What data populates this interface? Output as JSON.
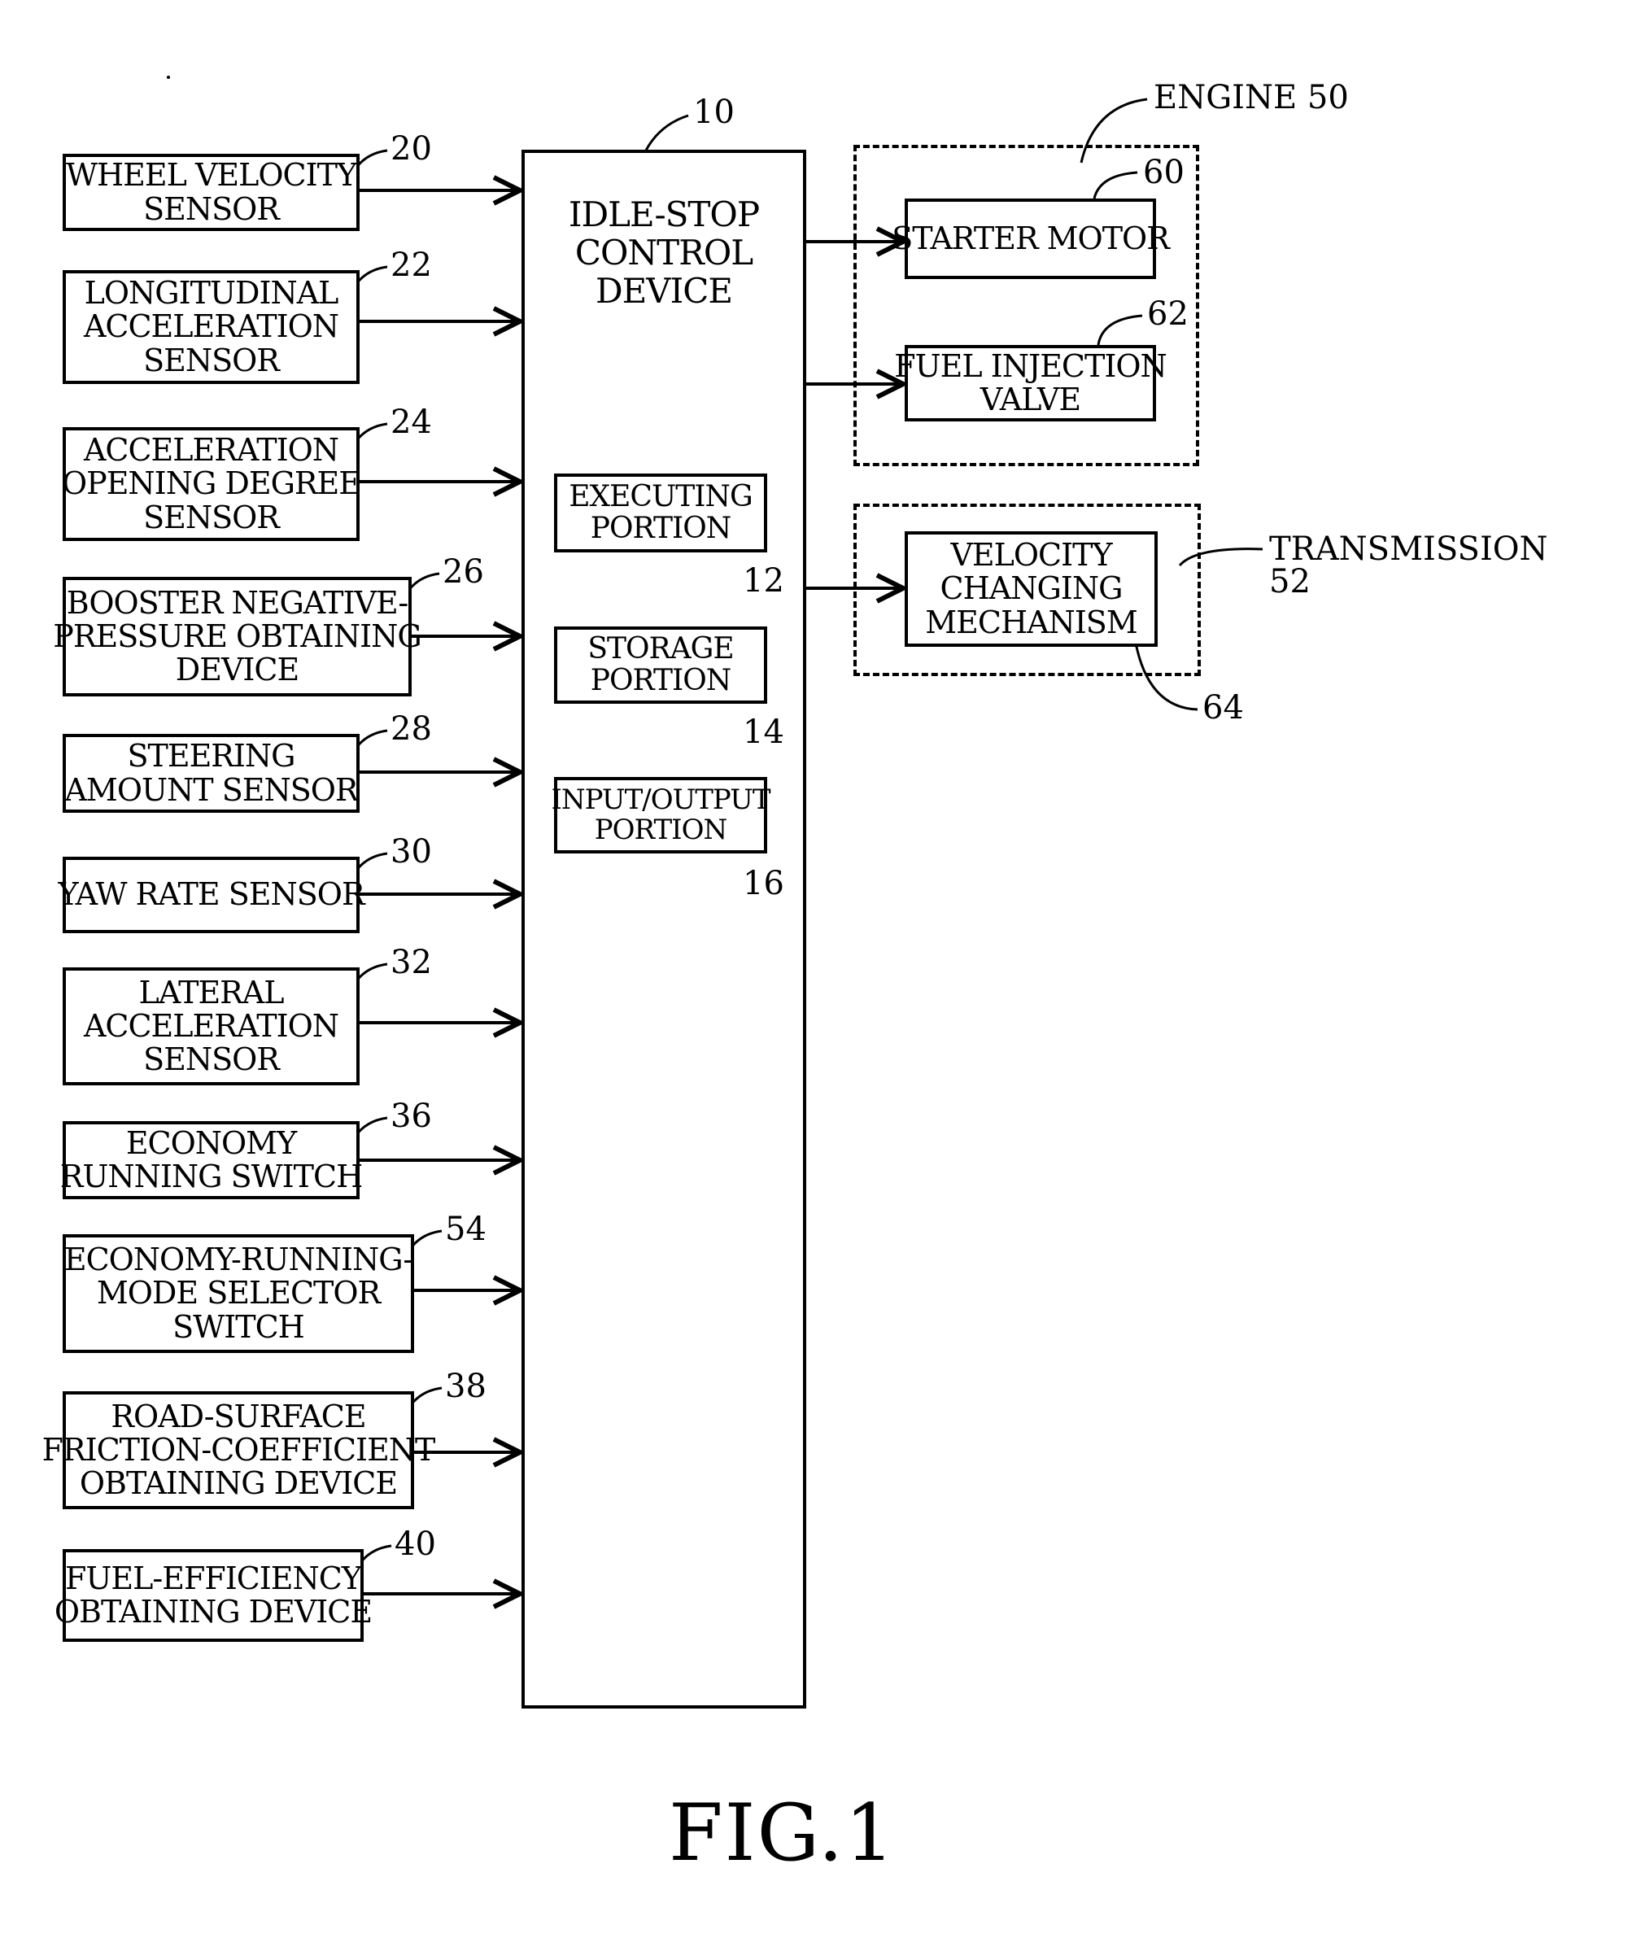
{
  "figure_label": "FIG.1",
  "control_device": {
    "ref": "10",
    "lines": [
      "IDLE-STOP",
      "CONTROL",
      "DEVICE"
    ],
    "portions": [
      {
        "ref": "12",
        "lines": [
          "EXECUTING",
          "PORTION"
        ]
      },
      {
        "ref": "14",
        "lines": [
          "STORAGE",
          "PORTION"
        ]
      },
      {
        "ref": "16",
        "lines": [
          "INPUT/OUTPUT",
          "PORTION"
        ]
      }
    ]
  },
  "inputs": [
    {
      "ref": "20",
      "lines": [
        "WHEEL VELOCITY",
        "SENSOR"
      ]
    },
    {
      "ref": "22",
      "lines": [
        "LONGITUDINAL",
        "ACCELERATION",
        "SENSOR"
      ]
    },
    {
      "ref": "24",
      "lines": [
        "ACCELERATION",
        "OPENING DEGREE",
        "SENSOR"
      ]
    },
    {
      "ref": "26",
      "lines": [
        "BOOSTER NEGATIVE-",
        "PRESSURE OBTAINING",
        "DEVICE"
      ]
    },
    {
      "ref": "28",
      "lines": [
        "STEERING",
        "AMOUNT SENSOR"
      ]
    },
    {
      "ref": "30",
      "lines": [
        "YAW RATE SENSOR"
      ]
    },
    {
      "ref": "32",
      "lines": [
        "LATERAL",
        "ACCELERATION",
        "SENSOR"
      ]
    },
    {
      "ref": "36",
      "lines": [
        "ECONOMY",
        "RUNNING SWITCH"
      ]
    },
    {
      "ref": "54",
      "lines": [
        "ECONOMY-RUNNING-",
        "MODE SELECTOR",
        "SWITCH"
      ]
    },
    {
      "ref": "38",
      "lines": [
        "ROAD-SURFACE",
        "FRICTION-COEFFICIENT",
        "OBTAINING DEVICE"
      ]
    },
    {
      "ref": "40",
      "lines": [
        "FUEL-EFFICIENCY",
        "OBTAINING DEVICE"
      ]
    }
  ],
  "engine": {
    "label": "ENGINE 50",
    "components": [
      {
        "ref": "60",
        "lines": [
          "STARTER MOTOR"
        ]
      },
      {
        "ref": "62",
        "lines": [
          "FUEL INJECTION",
          "VALVE"
        ]
      }
    ]
  },
  "transmission": {
    "label_lines": [
      "TRANSMISSION",
      "52"
    ],
    "components": [
      {
        "ref": "64",
        "lines": [
          "VELOCITY",
          "CHANGING",
          "MECHANISM"
        ]
      }
    ]
  }
}
